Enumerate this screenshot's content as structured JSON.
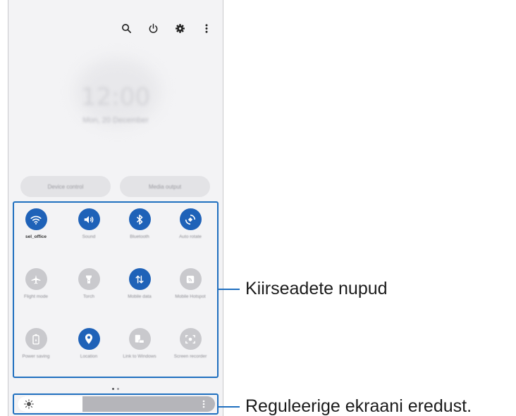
{
  "toolbar": {
    "icons": [
      "search-icon",
      "power-icon",
      "gear-icon",
      "more-vertical-icon"
    ]
  },
  "clock": {
    "time": "12:00",
    "date": "Mon, 20 December"
  },
  "buttons": {
    "device_control": "Device control",
    "media_output": "Media output"
  },
  "quick_settings": [
    {
      "label": "sel_office",
      "icon": "wifi-icon",
      "active": true
    },
    {
      "label": "Sound",
      "icon": "volume-icon",
      "active": true
    },
    {
      "label": "Bluetooth",
      "icon": "bluetooth-icon",
      "active": true
    },
    {
      "label": "Auto rotate",
      "icon": "rotate-icon",
      "active": true
    },
    {
      "label": "Flight mode",
      "icon": "airplane-icon",
      "active": false
    },
    {
      "label": "Torch",
      "icon": "flashlight-icon",
      "active": false
    },
    {
      "label": "Mobile data",
      "icon": "data-arrows-icon",
      "active": true
    },
    {
      "label": "Mobile Hotspot",
      "icon": "hotspot-icon",
      "active": false
    },
    {
      "label": "Power saving",
      "icon": "battery-icon",
      "active": false
    },
    {
      "label": "Location",
      "icon": "location-pin-icon",
      "active": true
    },
    {
      "label": "Link to Windows",
      "icon": "link-windows-icon",
      "active": false
    },
    {
      "label": "Screen recorder",
      "icon": "screen-recorder-icon",
      "active": false
    }
  ],
  "brightness": {
    "level": 0.33,
    "icon": "sun-icon"
  },
  "callouts": {
    "quick_buttons": "Kiirseadete nupud",
    "brightness": "Reguleerige ekraani eredust."
  },
  "colors": {
    "accent": "#1f62b8",
    "callout": "#1f6fbf",
    "inactive": "#c9c9cd"
  }
}
